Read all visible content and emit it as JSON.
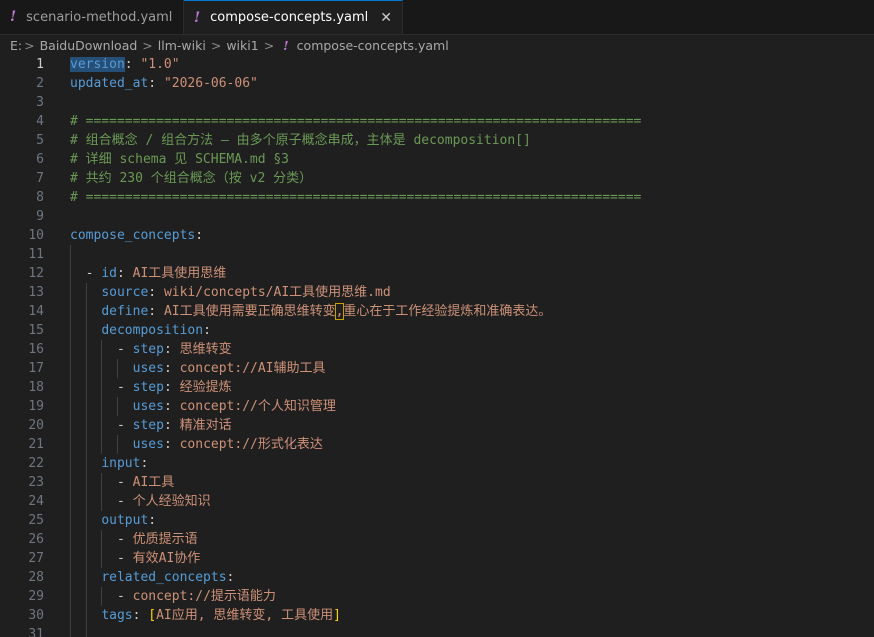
{
  "tabs": [
    {
      "icon": "!",
      "label": "scenario-method.yaml"
    },
    {
      "icon": "!",
      "label": "compose-concepts.yaml",
      "close": "✕"
    }
  ],
  "breadcrumb": [
    "E:",
    "BaiduDownload",
    "llm-wiki",
    "wiki1",
    "compose-concepts.yaml"
  ],
  "breadcrumb_sep": ">",
  "breadcrumb_icon": "!",
  "lines": [
    {
      "n": "1",
      "parts": [
        [
          "k",
          "version"
        ],
        [
          "p",
          ": "
        ],
        [
          "s",
          "\"1.0\""
        ]
      ]
    },
    {
      "n": "2",
      "parts": [
        [
          "k",
          "updated_at"
        ],
        [
          "p",
          ": "
        ],
        [
          "s",
          "\"2026-06-06\""
        ]
      ]
    },
    {
      "n": "3",
      "parts": []
    },
    {
      "n": "4",
      "parts": [
        [
          "c",
          "# ======================================================================="
        ]
      ]
    },
    {
      "n": "5",
      "parts": [
        [
          "c",
          "# 组合概念 / 组合方法 — 由多个原子概念串成，主体是 decomposition[]"
        ]
      ]
    },
    {
      "n": "6",
      "parts": [
        [
          "c",
          "# 详细 schema 见 SCHEMA.md §3"
        ]
      ]
    },
    {
      "n": "7",
      "parts": [
        [
          "c",
          "# 共约 230 个组合概念（按 v2 分类）"
        ]
      ]
    },
    {
      "n": "8",
      "parts": [
        [
          "c",
          "# ======================================================================="
        ]
      ]
    },
    {
      "n": "9",
      "parts": []
    },
    {
      "n": "10",
      "parts": [
        [
          "k",
          "compose_concepts"
        ],
        [
          "p",
          ":"
        ]
      ]
    },
    {
      "n": "11",
      "parts": []
    },
    {
      "n": "12",
      "parts": [
        [
          "p",
          "  - "
        ],
        [
          "k",
          "id"
        ],
        [
          "p",
          ": "
        ],
        [
          "s",
          "AI工具使用思维"
        ]
      ]
    },
    {
      "n": "13",
      "parts": [
        [
          "p",
          "    "
        ],
        [
          "k",
          "source"
        ],
        [
          "p",
          ": "
        ],
        [
          "s",
          "wiki/concepts/AI工具使用思维.md"
        ]
      ]
    },
    {
      "n": "14",
      "parts": [
        [
          "p",
          "    "
        ],
        [
          "k",
          "define"
        ],
        [
          "p",
          ": "
        ],
        [
          "s",
          "AI工具使用需要正确思维转变"
        ],
        [
          "s",
          ","
        ],
        [
          "s",
          "重心在于工作经验提炼和准确表达。"
        ]
      ]
    },
    {
      "n": "15",
      "parts": [
        [
          "p",
          "    "
        ],
        [
          "k",
          "decomposition"
        ],
        [
          "p",
          ":"
        ]
      ]
    },
    {
      "n": "16",
      "parts": [
        [
          "p",
          "      - "
        ],
        [
          "k",
          "step"
        ],
        [
          "p",
          ": "
        ],
        [
          "s",
          "思维转变"
        ]
      ]
    },
    {
      "n": "17",
      "parts": [
        [
          "p",
          "        "
        ],
        [
          "k",
          "uses"
        ],
        [
          "p",
          ": "
        ],
        [
          "s",
          "concept://AI辅助工具"
        ]
      ]
    },
    {
      "n": "18",
      "parts": [
        [
          "p",
          "      - "
        ],
        [
          "k",
          "step"
        ],
        [
          "p",
          ": "
        ],
        [
          "s",
          "经验提炼"
        ]
      ]
    },
    {
      "n": "19",
      "parts": [
        [
          "p",
          "        "
        ],
        [
          "k",
          "uses"
        ],
        [
          "p",
          ": "
        ],
        [
          "s",
          "concept://个人知识管理"
        ]
      ]
    },
    {
      "n": "20",
      "parts": [
        [
          "p",
          "      - "
        ],
        [
          "k",
          "step"
        ],
        [
          "p",
          ": "
        ],
        [
          "s",
          "精准对话"
        ]
      ]
    },
    {
      "n": "21",
      "parts": [
        [
          "p",
          "        "
        ],
        [
          "k",
          "uses"
        ],
        [
          "p",
          ": "
        ],
        [
          "s",
          "concept://形式化表达"
        ]
      ]
    },
    {
      "n": "22",
      "parts": [
        [
          "p",
          "    "
        ],
        [
          "k",
          "input"
        ],
        [
          "p",
          ":"
        ]
      ]
    },
    {
      "n": "23",
      "parts": [
        [
          "p",
          "      - "
        ],
        [
          "s",
          "AI工具"
        ]
      ]
    },
    {
      "n": "24",
      "parts": [
        [
          "p",
          "      - "
        ],
        [
          "s",
          "个人经验知识"
        ]
      ]
    },
    {
      "n": "25",
      "parts": [
        [
          "p",
          "    "
        ],
        [
          "k",
          "output"
        ],
        [
          "p",
          ":"
        ]
      ]
    },
    {
      "n": "26",
      "parts": [
        [
          "p",
          "      - "
        ],
        [
          "s",
          "优质提示语"
        ]
      ]
    },
    {
      "n": "27",
      "parts": [
        [
          "p",
          "      - "
        ],
        [
          "s",
          "有效AI协作"
        ]
      ]
    },
    {
      "n": "28",
      "parts": [
        [
          "p",
          "    "
        ],
        [
          "k",
          "related_concepts"
        ],
        [
          "p",
          ":"
        ]
      ]
    },
    {
      "n": "29",
      "parts": [
        [
          "p",
          "      - "
        ],
        [
          "s",
          "concept://提示语能力"
        ]
      ]
    },
    {
      "n": "30",
      "parts": [
        [
          "p",
          "    "
        ],
        [
          "k",
          "tags"
        ],
        [
          "p",
          ": "
        ],
        [
          "b",
          "["
        ],
        [
          "s",
          "AI应用, 思维转变, 工具使用"
        ],
        [
          "b",
          "]"
        ]
      ]
    },
    {
      "n": "31",
      "parts": []
    }
  ],
  "current_line": "1",
  "colors": {
    "keyword": "#569cd6",
    "string": "#ce9178",
    "comment": "#6a9955",
    "bracket": "#ffd700"
  }
}
